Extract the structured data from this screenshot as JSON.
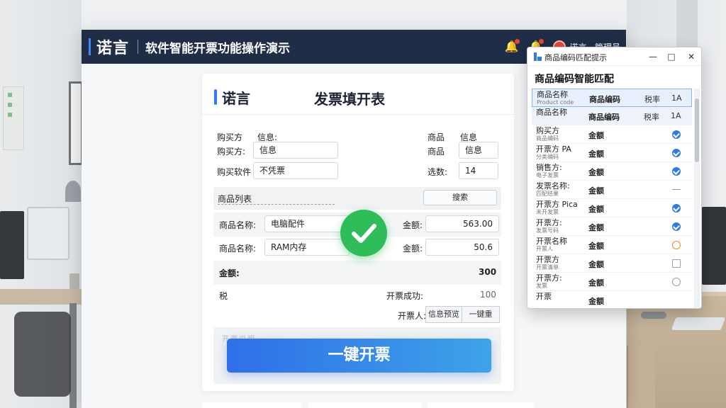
{
  "header": {
    "brand": "诺言",
    "title": "软件智能开票功能操作演示",
    "user_name": "诺言 · 管理员"
  },
  "card": {
    "logo": "诺言",
    "title": "发票填开表",
    "buyer_header": "购买方",
    "buyer_info_label": "信息:",
    "buyer_label": "购买方:",
    "buyer_value": "信息",
    "software_label": "购买软件",
    "software_value": "不凭票",
    "goods_header": "商品",
    "goods_info_label": "信息",
    "goods_label": "商品",
    "goods_value": "信息",
    "qty_label": "选数:",
    "qty_value": "14",
    "section_label": "商品列表",
    "section_button": "搜索",
    "rows": [
      {
        "name_label": "商品名称:",
        "name_value": "电脑配件",
        "amount_label": "金额:",
        "amount_value": "563.00"
      },
      {
        "name_label": "商品名称:",
        "name_value": "RAM内存",
        "amount_label": "金额:",
        "amount_value": "50.6"
      }
    ],
    "total_label": "金额:",
    "total_value": "300",
    "summary_left": "税",
    "success_label": "开票成功:",
    "success_value": "100",
    "opener_label": "开票人:",
    "btn_preview": "信息预览",
    "btn_reset": "一键重",
    "footer_hint": "开票说明 · · · · · · · · · ·",
    "issue_button": "一键开票"
  },
  "popup": {
    "window_title": "商品编码匹配提示",
    "heading": "商品编码智能匹配",
    "rows": [
      {
        "c1": "商品名称",
        "c1_sub": "Product code",
        "c2": "商品编码",
        "c3": "税率",
        "c4": "1A",
        "status": "none",
        "style": "sel"
      },
      {
        "c1": "商品名称",
        "c1_sub": "",
        "c2": "商品编码",
        "c3": "税率",
        "c4": "1A",
        "status": "none",
        "style": "sel2"
      },
      {
        "c1": "购买方",
        "c1_sub": "商品编码",
        "c2": "金额",
        "c3": "",
        "c4": "",
        "status": "ok",
        "style": ""
      },
      {
        "c1": "开票方 PA",
        "c1_sub": "分类编码",
        "c2": "金额",
        "c3": "",
        "c4": "",
        "status": "ok",
        "style": ""
      },
      {
        "c1": "销售方:",
        "c1_sub": "电子发票",
        "c2": "金额",
        "c3": "",
        "c4": "",
        "status": "ok",
        "style": ""
      },
      {
        "c1": "发票名称:",
        "c1_sub": "匹配结果",
        "c2": "金额",
        "c3": "",
        "c4": "",
        "status": "dash",
        "style": ""
      },
      {
        "c1": "开票方 Pica",
        "c1_sub": "未开发票",
        "c2": "金额",
        "c3": "",
        "c4": "",
        "status": "ok",
        "style": ""
      },
      {
        "c1": "开票方:",
        "c1_sub": "发票号码",
        "c2": "金额",
        "c3": "",
        "c4": "",
        "status": "ok",
        "style": ""
      },
      {
        "c1": "开票名称",
        "c1_sub": "开票人",
        "c2": "金额",
        "c3": "",
        "c4": "",
        "status": "warn",
        "style": ""
      },
      {
        "c1": "开票方",
        "c1_sub": "开票清单",
        "c2": "金额",
        "c3": "",
        "c4": "",
        "status": "empty",
        "style": ""
      },
      {
        "c1": "开票方:",
        "c1_sub": "发票",
        "c2": "金额",
        "c3": "",
        "c4": "",
        "status": "search",
        "style": ""
      },
      {
        "c1": "开票",
        "c1_sub": "",
        "c2": "金额",
        "c3": "",
        "c4": "",
        "status": "none",
        "style": ""
      }
    ]
  },
  "colors": {
    "header_bg": "#1f2d47",
    "accent": "#2f7cf0",
    "success": "#2ebd59",
    "warn": "#f08a24"
  }
}
